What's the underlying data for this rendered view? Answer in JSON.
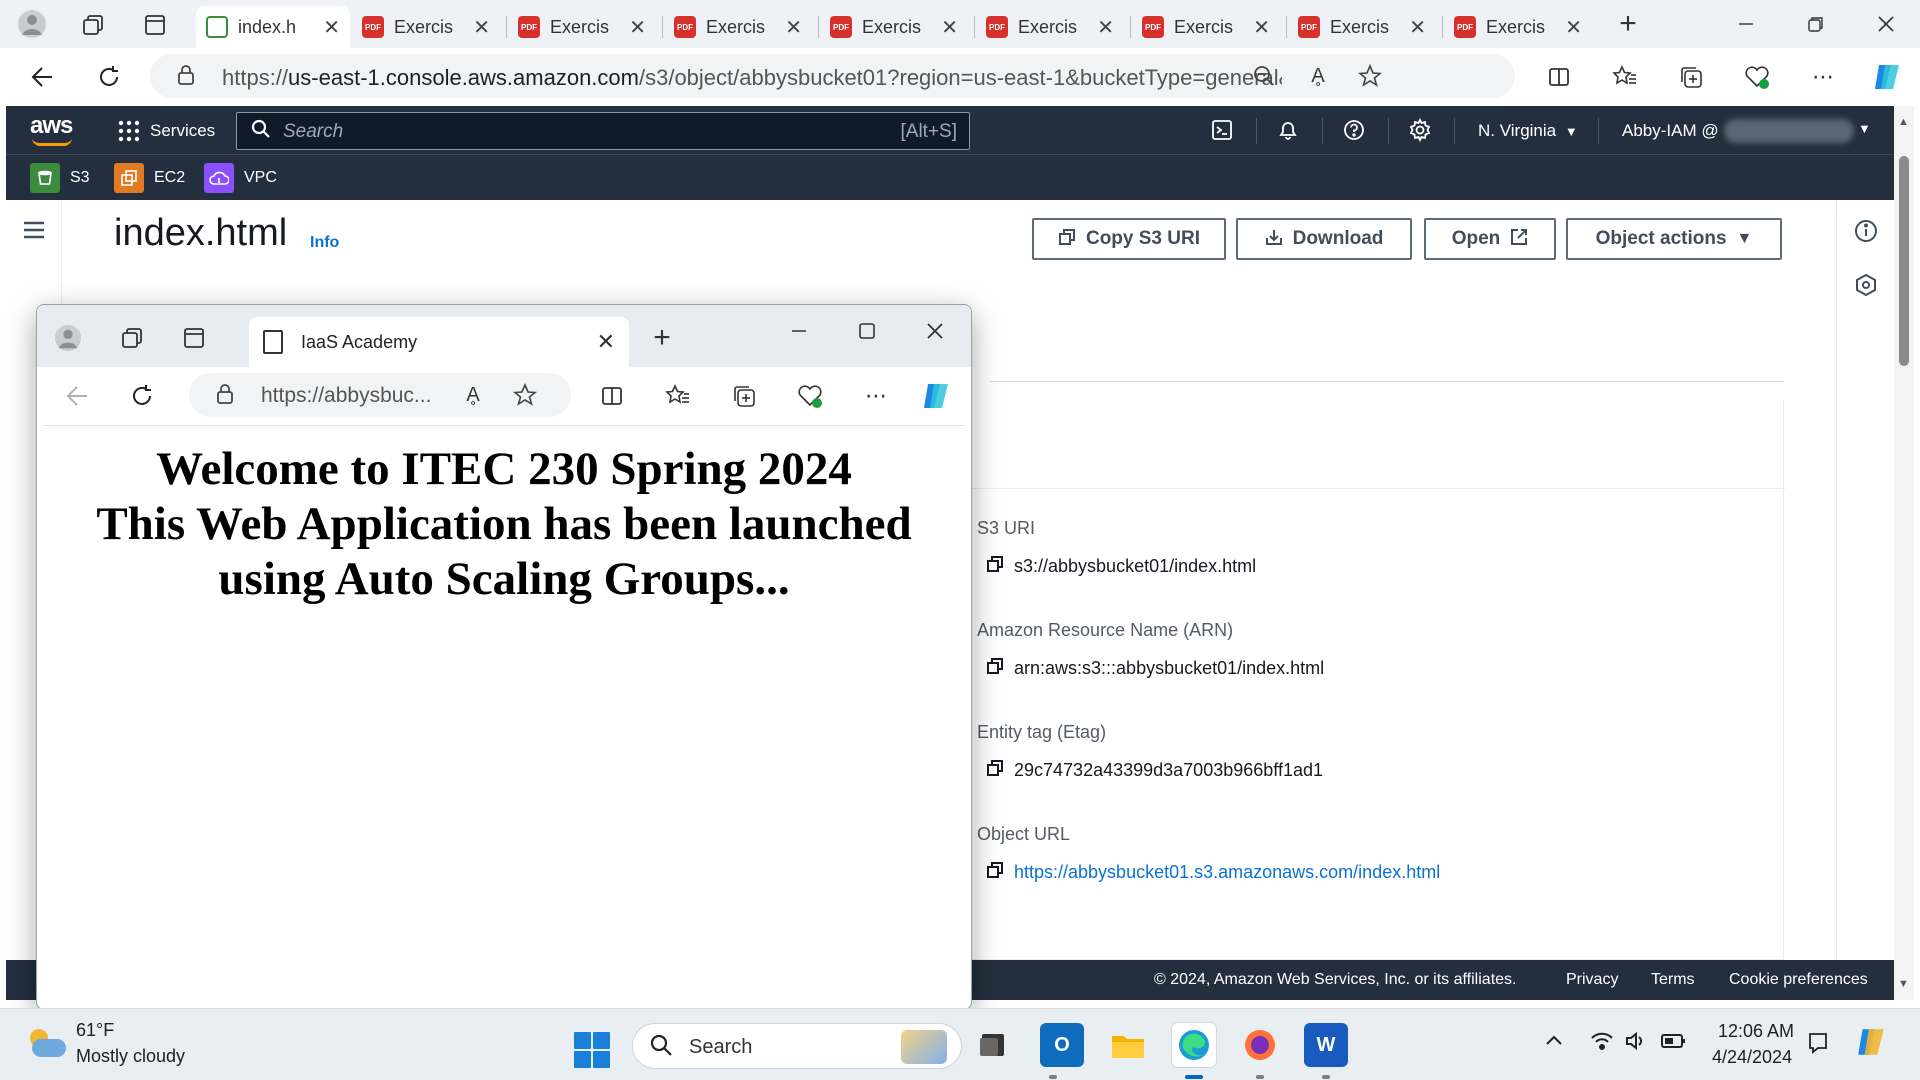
{
  "browser": {
    "tabs": [
      {
        "title": "index.h",
        "favicon": "s3-icon",
        "active": true
      },
      {
        "title": "Exercis",
        "favicon": "pdf-icon"
      },
      {
        "title": "Exercis",
        "favicon": "pdf-icon"
      },
      {
        "title": "Exercis",
        "favicon": "pdf-icon"
      },
      {
        "title": "Exercis",
        "favicon": "pdf-icon"
      },
      {
        "title": "Exercis",
        "favicon": "pdf-icon"
      },
      {
        "title": "Exercis",
        "favicon": "pdf-icon"
      },
      {
        "title": "Exercis",
        "favicon": "pdf-icon"
      },
      {
        "title": "Exercis",
        "favicon": "pdf-icon"
      }
    ],
    "pdf_badge": "PDF",
    "new_tab": "+",
    "url_prefix": "https://",
    "url_host": "us-east-1.console.aws.amazon.com",
    "url_rest": "/s3/object/abbysbucket01?region=us-east-1&bucketType=general&prefix..."
  },
  "aws": {
    "logo": "aws",
    "services_label": "Services",
    "search_placeholder": "Search",
    "search_shortcut": "[Alt+S]",
    "region": "N. Virginia",
    "account": "Abby-IAM @",
    "favorites": [
      {
        "label": "S3",
        "color": "#3b8a3e"
      },
      {
        "label": "EC2",
        "color": "#e07b24"
      },
      {
        "label": "VPC",
        "color": "#8c4fff"
      }
    ]
  },
  "object": {
    "title": "index.html",
    "info_label": "Info",
    "buttons": {
      "copy_uri": "Copy S3 URI",
      "download": "Download",
      "open": "Open",
      "object_actions": "Object actions"
    },
    "properties": [
      {
        "label": "S3 URI",
        "value": "s3://abbysbucket01/index.html",
        "link": false
      },
      {
        "label": "Amazon Resource Name (ARN)",
        "value": "arn:aws:s3:::abbysbucket01/index.html",
        "link": false
      },
      {
        "label": "Entity tag (Etag)",
        "value": "29c74732a43399d3a7003b966bff1ad1",
        "link": false
      },
      {
        "label": "Object URL",
        "value": "https://abbysbucket01.s3.amazonaws.com/index.html",
        "link": true
      }
    ]
  },
  "footer": {
    "copyright": "© 2024, Amazon Web Services, Inc. or its affiliates.",
    "privacy": "Privacy",
    "terms": "Terms",
    "cookies": "Cookie preferences"
  },
  "popup": {
    "tab_title": "IaaS Academy",
    "url": "https://abbysbuc...",
    "heading_lines": [
      "Welcome to ITEC 230 Spring 2024",
      "This Web Application has been launched",
      "using Auto Scaling Groups..."
    ]
  },
  "taskbar": {
    "temperature": "61°F",
    "condition": "Mostly cloudy",
    "search_placeholder": "Search",
    "time": "12:06 AM",
    "date": "4/24/2024"
  }
}
